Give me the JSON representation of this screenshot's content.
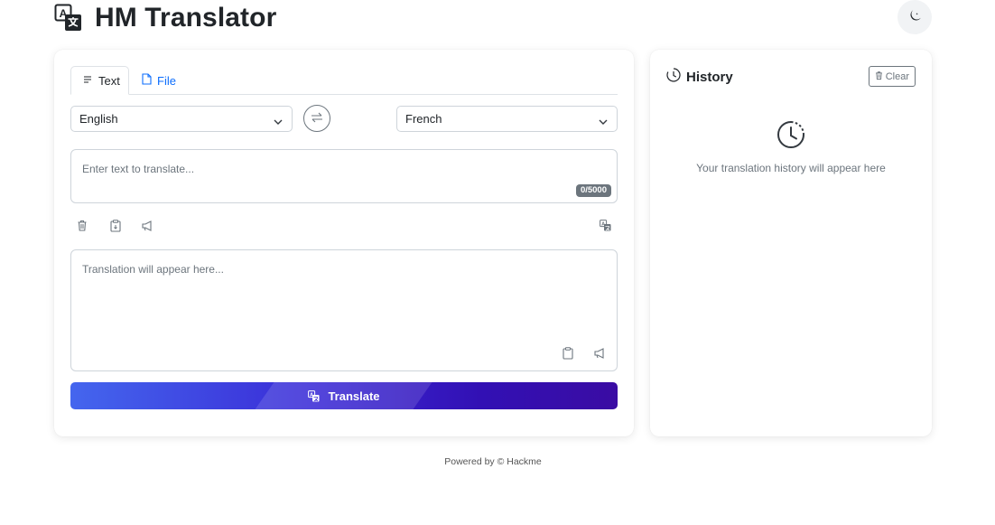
{
  "app": {
    "title": "HM Translator",
    "logo_icon": "translate-logo-icon",
    "theme_toggle_icon": "moon-icon"
  },
  "tabs": [
    {
      "label": "Text",
      "icon": "text-lines-icon",
      "active": true
    },
    {
      "label": "File",
      "icon": "file-icon",
      "active": false
    }
  ],
  "languages": {
    "source": "English",
    "target": "French",
    "swap_icon": "swap-arrows-icon"
  },
  "input": {
    "placeholder": "Enter text to translate...",
    "char_count": "0/5000"
  },
  "input_actions": [
    "trash-icon",
    "paste-icon",
    "speaker-icon",
    "translate-detect-icon"
  ],
  "output": {
    "placeholder": "Translation will appear here...",
    "actions": [
      "copy-icon",
      "speaker-icon"
    ]
  },
  "translate_button": {
    "label": "Translate",
    "icon": "translate-icon"
  },
  "history": {
    "title": "History",
    "clear_label": "Clear",
    "empty_message": "Your translation history will appear here"
  },
  "footer": {
    "text": "Powered by © Hackme"
  },
  "colors": {
    "accent": "#0d6efd",
    "button_gradient_start": "#4466ee",
    "button_gradient_end": "#3a0ca3",
    "muted": "#6c757d"
  }
}
